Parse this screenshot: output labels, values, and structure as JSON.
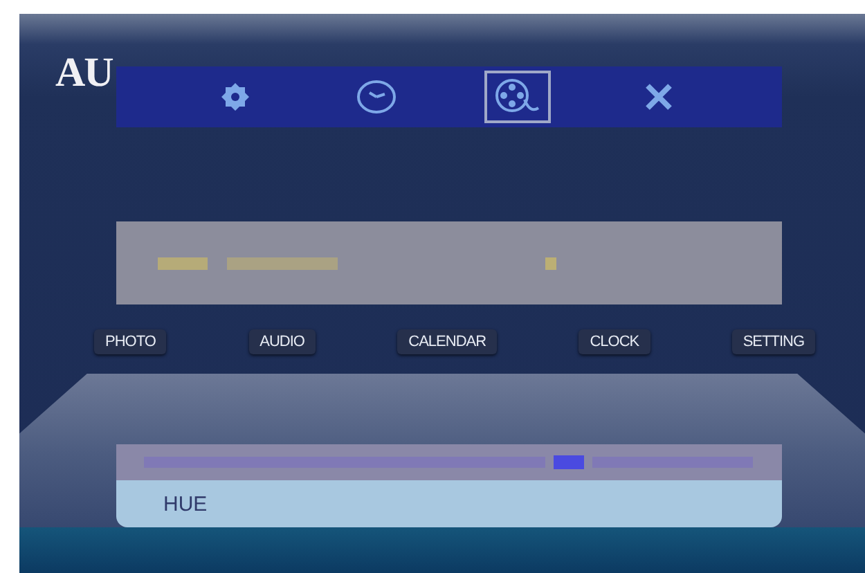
{
  "logo": {
    "text": "AU"
  },
  "toolbar": [
    {
      "kind": "gear",
      "selected": false
    },
    {
      "kind": "clock",
      "selected": false
    },
    {
      "kind": "reel",
      "selected": true
    },
    {
      "kind": "close",
      "selected": false
    }
  ],
  "menu": [
    {
      "label": "PHOTO"
    },
    {
      "label": "AUDIO"
    },
    {
      "label": "CALENDAR"
    },
    {
      "label": "CLOCK"
    },
    {
      "label": "SETTING"
    }
  ],
  "settings_panel": {
    "item": "HUE"
  }
}
